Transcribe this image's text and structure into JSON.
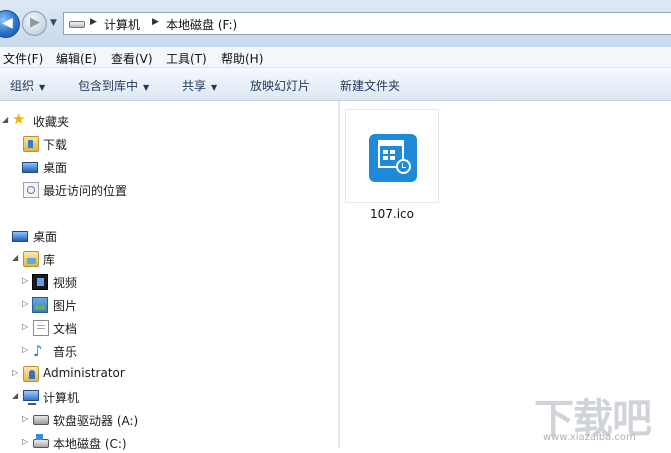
{
  "address": {
    "path": [
      "计算机",
      "本地磁盘 (F:)"
    ],
    "back_arrow": "◀",
    "forward_arrow": "▶",
    "dropdown": "▼"
  },
  "menu": [
    "文件(F)",
    "编辑(E)",
    "查看(V)",
    "工具(T)",
    "帮助(H)"
  ],
  "toolbar": [
    {
      "label": "组织",
      "dropdown": true
    },
    {
      "label": "包含到库中",
      "dropdown": true
    },
    {
      "label": "共享",
      "dropdown": true
    },
    {
      "label": "放映幻灯片",
      "dropdown": false
    },
    {
      "label": "新建文件夹",
      "dropdown": false
    }
  ],
  "nav": {
    "favorites": {
      "label": "收藏夹",
      "items": [
        "下载",
        "桌面",
        "最近访问的位置"
      ]
    },
    "desktop": "桌面",
    "libraries": {
      "label": "库",
      "items": [
        "视频",
        "图片",
        "文档",
        "音乐"
      ]
    },
    "user": "Administrator",
    "computer": {
      "label": "计算机",
      "items": [
        "软盘驱动器 (A:)",
        "本地磁盘 (C:)"
      ]
    }
  },
  "files": [
    {
      "name": "107.ico",
      "icon": "calendar-clock-icon"
    }
  ],
  "watermark": {
    "text": "下载吧",
    "url": "www.xiazaiba.com"
  },
  "colors": {
    "accent": "#1f8bd8",
    "toolbar_text": "#1e395b"
  }
}
